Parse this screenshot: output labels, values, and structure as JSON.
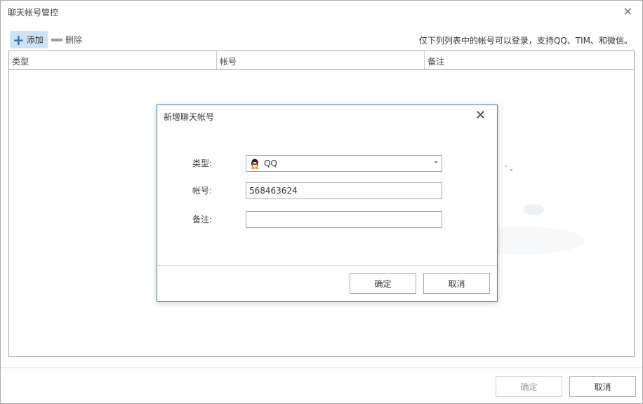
{
  "window": {
    "title": "聊天帐号管控"
  },
  "toolbar": {
    "add_label": "添加",
    "delete_label": "删除",
    "hint": "仅下列列表中的帐号可以登录，支持QQ、TIM、和微信。"
  },
  "table": {
    "columns": [
      "类型",
      "帐号",
      "备注"
    ],
    "rows": []
  },
  "footer": {
    "ok_label": "确定",
    "cancel_label": "取消"
  },
  "dialog": {
    "title": "新增聊天帐号",
    "type_label": "类型:",
    "type_value": "QQ",
    "account_label": "帐号:",
    "account_value": "568463624",
    "note_label": "备注:",
    "note_value": "",
    "ok_label": "确定",
    "cancel_label": "取消"
  }
}
